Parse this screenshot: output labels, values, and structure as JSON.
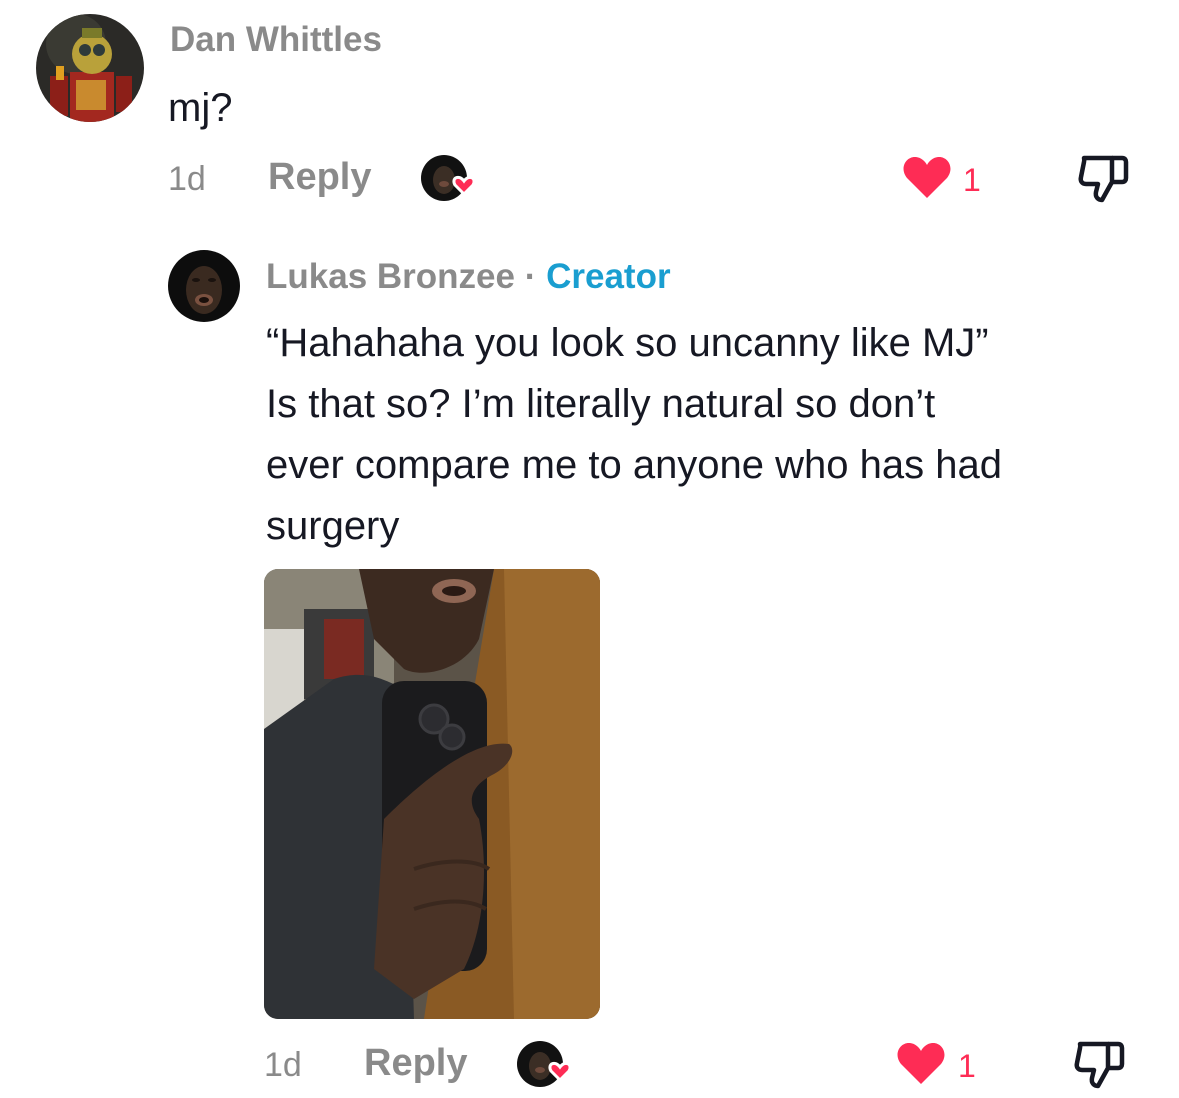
{
  "comments": [
    {
      "username": "Dan Whittles",
      "text": "mj?",
      "time": "1d",
      "reply_label": "Reply",
      "like_count": "1"
    }
  ],
  "reply": {
    "username": "Lukas Bronzee",
    "separator": "·",
    "creator_label": "Creator",
    "text_lines": [
      "“Hahahaha you look so uncanny like MJ”",
      "Is that so? I’m literally natural so don’t",
      "ever compare me to anyone who has had",
      "surgery"
    ],
    "time": "1d",
    "reply_label": "Reply",
    "like_count": "1"
  },
  "colors": {
    "like": "#fe2c55",
    "creator": "#1a9ed0",
    "muted": "#8a8a8a",
    "text": "#161823"
  },
  "icons": [
    "heart-icon",
    "dislike-icon",
    "creator-liked-avatar-icon"
  ]
}
